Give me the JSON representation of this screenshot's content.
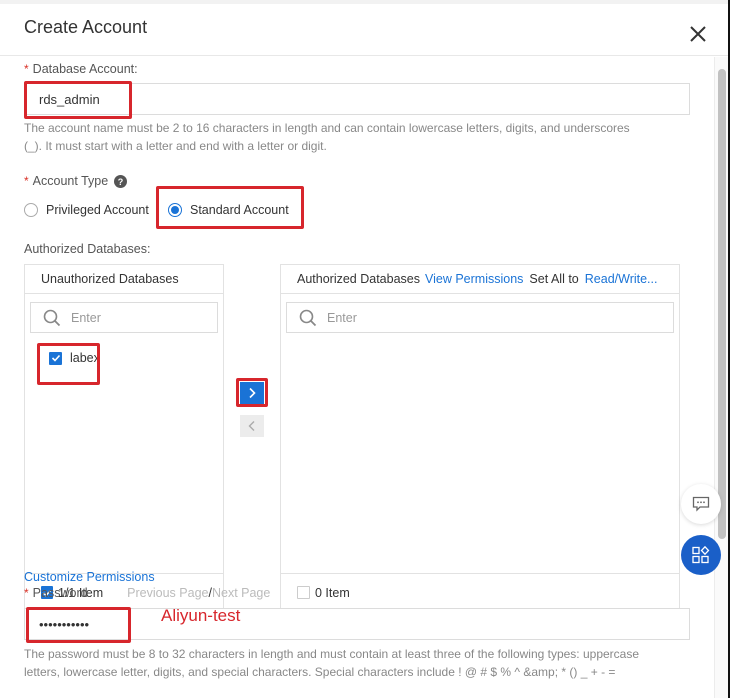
{
  "dialog": {
    "title": "Create Account",
    "close_icon": "close-icon"
  },
  "account": {
    "label": "Database Account:",
    "value": "rds_admin",
    "help": "The account name must be 2 to 16 characters in length and can contain lowercase letters, digits, and underscores",
    "help_line2": "(_). It must start with a letter and end with a letter or digit."
  },
  "account_type": {
    "label": "Account Type",
    "help_icon": "question-circle-icon",
    "options": [
      {
        "label": "Privileged Account",
        "selected": false
      },
      {
        "label": "Standard Account",
        "selected": true
      }
    ]
  },
  "authorized_databases": {
    "label": "Authorized Databases:",
    "left": {
      "title": "Unauthorized Databases",
      "search_placeholder": "Enter",
      "items": [
        {
          "label": "labex",
          "checked": true
        }
      ],
      "footer_count": "1/1 Item",
      "footer_checked": true,
      "prev_page": "Previous Page",
      "separator": "/",
      "next_page": "Next Page"
    },
    "right": {
      "title": "Authorized Databases",
      "view_permissions": "View Permissions",
      "set_all_to": "Set All to",
      "set_all_value": "Read/Write...",
      "search_placeholder": "Enter",
      "items": [],
      "footer_count": "0 Item",
      "footer_checked": false
    },
    "move_right_icon": "chevron-right-icon",
    "move_left_icon": "chevron-left-icon"
  },
  "customize_permissions": "Customize Permissions",
  "password": {
    "label": "Password",
    "value": "•••••••••••",
    "annotation": "Aliyun-test",
    "help": "The password must be 8 to 32 characters in length and must contain at least three of the following types: uppercase",
    "help_line2": "letters, lowercase letter, digits, and special characters. Special characters include ! @ # $ % ^ &amp; * () _ + - ="
  },
  "floating": {
    "chat_icon": "chat-bubble-icon",
    "apps_icon": "apps-grid-icon"
  },
  "colors": {
    "accent": "#1a73d6",
    "highlight": "#d7262c",
    "required": "#d93026"
  }
}
